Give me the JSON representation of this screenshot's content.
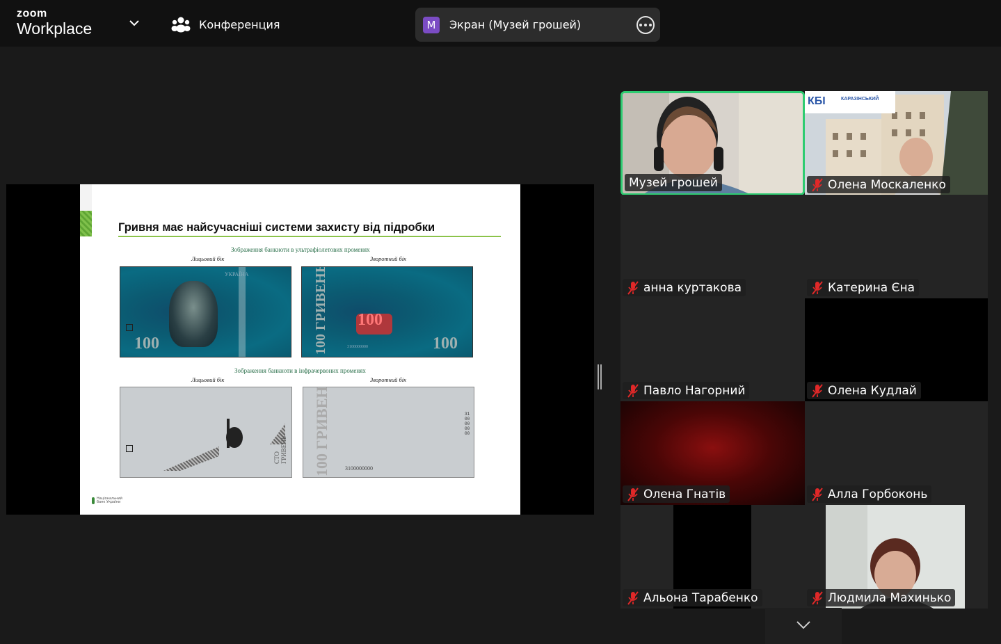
{
  "app": {
    "logo_top": "zoom",
    "logo_bottom": "Workplace",
    "conference_label": "Конференция"
  },
  "share_pill": {
    "avatar_letter": "M",
    "label": "Экран (Музей грошей)",
    "avatar_color": "#7b4cc4"
  },
  "slide": {
    "title": "Гривня має найсучасніші системи захисту від підробки",
    "uv_caption": "Зображення банкноти в ультрафіолетових променях",
    "ir_caption": "Зображення банкноти в інфрачервоних променях",
    "front_label": "Лицьовий бік",
    "back_label": "Зворотний бік",
    "uv_front_num": "100",
    "uv_back_num_left": "100",
    "uv_back_num_right": "100",
    "uv_back_center": "100",
    "uv_back_vertical": "100 ГРИВЕНЬ 100",
    "uv_front_top": "УКРАЇНА",
    "ir_back_vertical": "100 ГРИВЕНЬ 100",
    "ir_front_vertical": "СТО ГРИВЕНЬ",
    "ir_back_serial": "3100000000",
    "ir_back_serial_vertical": "3100000000",
    "uv_back_serial": "3100000000",
    "nbu_line1": "Національний",
    "nbu_line2": "банк України"
  },
  "participants": [
    {
      "name": "Музей грошей",
      "muted": false,
      "active": true
    },
    {
      "name": "Олена Москаленко",
      "muted": true,
      "active": false
    },
    {
      "name": "анна куртакова",
      "muted": true,
      "active": false
    },
    {
      "name": "Катерина Єна",
      "muted": true,
      "active": false
    },
    {
      "name": "Павло Нагорний",
      "muted": true,
      "active": false
    },
    {
      "name": "Олена Кудлай",
      "muted": true,
      "active": false
    },
    {
      "name": "Олена Гнатів",
      "muted": true,
      "active": false
    },
    {
      "name": "Алла Горбоконь",
      "muted": true,
      "active": false
    },
    {
      "name": "Альона Тарабенко",
      "muted": true,
      "active": false
    },
    {
      "name": "Людмила Махинько",
      "muted": true,
      "active": false
    }
  ],
  "kbi_banner": {
    "abbr": "КБІ",
    "text": "КАРАЗІНСЬКИЙ"
  },
  "colors": {
    "active_border": "#2ecc71",
    "mute_red": "#e02828",
    "slide_accent": "#8bc34a"
  }
}
